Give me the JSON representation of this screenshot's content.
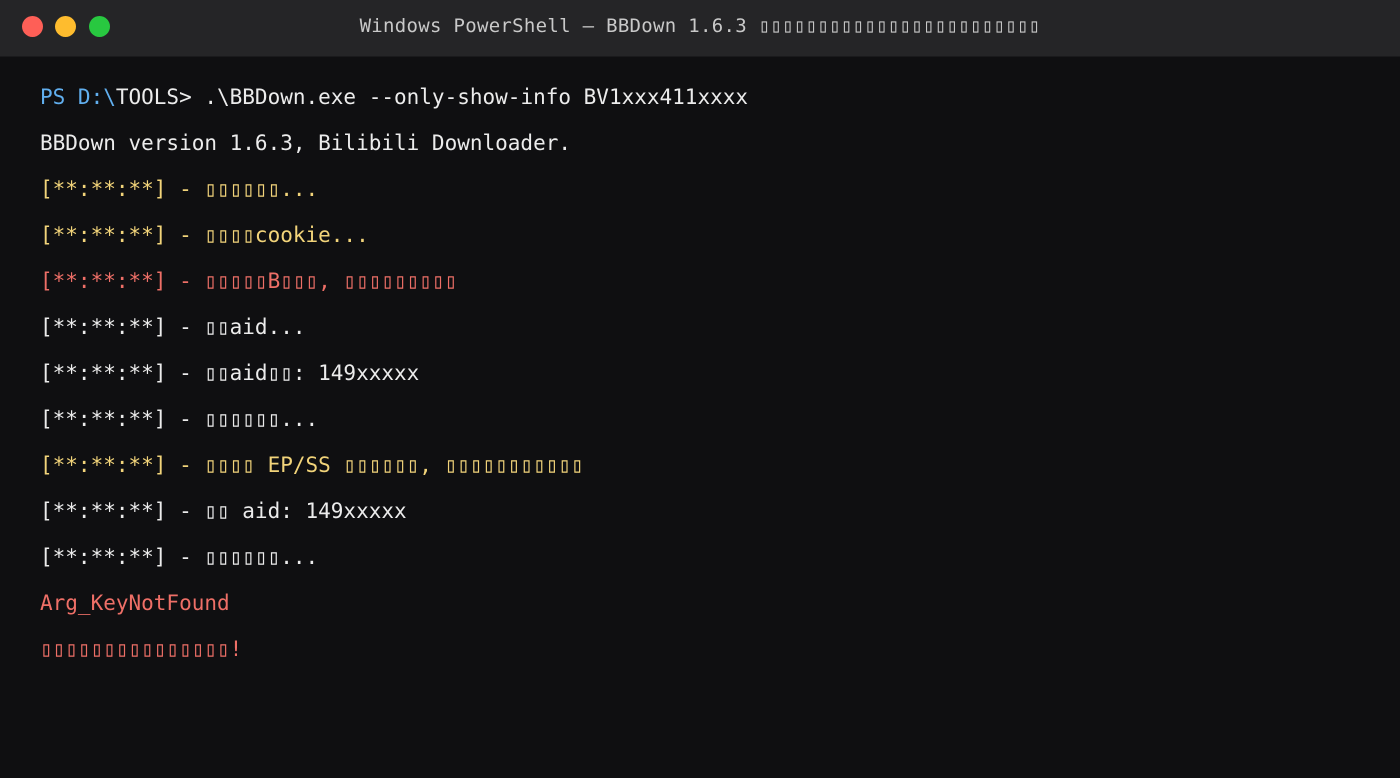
{
  "window": {
    "title": "Windows PowerShell — BBDown 1.6.3 ▯▯▯▯▯▯▯▯▯▯▯▯▯▯▯▯▯▯▯▯▯▯▯▯"
  },
  "colors": {
    "background": "#0f0f11",
    "titlebar": "#252527",
    "text": "#ececec",
    "prompt": "#61afef",
    "warning": "#f2d47a",
    "error": "#ee6f67"
  },
  "terminal": {
    "prompt": {
      "ps": "PS D:\\",
      "path_and_command": "TOOLS> .\\BBDown.exe --only-show-info BV1xxx411xxxx"
    },
    "lines": [
      {
        "text": "BBDown version 1.6.3, Bilibili Downloader.",
        "level": "info"
      },
      {
        "text": "[**:**:**] - ▯▯▯▯▯▯...",
        "level": "warn"
      },
      {
        "text": "[**:**:**] - ▯▯▯▯cookie...",
        "level": "warn"
      },
      {
        "text": "[**:**:**] - ▯▯▯▯▯B▯▯▯, ▯▯▯▯▯▯▯▯▯",
        "level": "error"
      },
      {
        "text": "[**:**:**] - ▯▯aid...",
        "level": "info"
      },
      {
        "text": "[**:**:**] - ▯▯aid▯▯: 149xxxxx",
        "level": "info"
      },
      {
        "text": "[**:**:**] - ▯▯▯▯▯▯...",
        "level": "info"
      },
      {
        "text": "[**:**:**] - ▯▯▯▯ EP/SS ▯▯▯▯▯▯, ▯▯▯▯▯▯▯▯▯▯▯",
        "level": "warn"
      },
      {
        "text": "[**:**:**] - ▯▯ aid: 149xxxxx",
        "level": "info"
      },
      {
        "text": "[**:**:**] - ▯▯▯▯▯▯...",
        "level": "info"
      },
      {
        "text": "Arg_KeyNotFound",
        "level": "error"
      },
      {
        "text": "▯▯▯▯▯▯▯▯▯▯▯▯▯▯▯!",
        "level": "error"
      }
    ]
  }
}
